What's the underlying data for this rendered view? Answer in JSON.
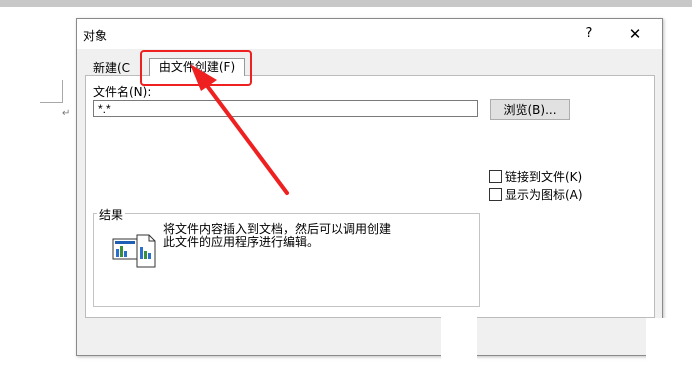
{
  "dialog": {
    "title": "对象",
    "help_label": "?",
    "close_label": "✕"
  },
  "tabs": {
    "create_new": "新建(C",
    "create_from_file": "由文件创建(F)"
  },
  "file": {
    "label": "文件名(N):",
    "value": "*.*",
    "browse_label": "浏览(B)..."
  },
  "options": {
    "link_to_file": "链接到文件(K)",
    "display_as_icon": "显示为图标(A)"
  },
  "result": {
    "label": "结果",
    "line1": "将文件内容插入到文档，然后可以调用创建",
    "line2": "此文件的应用程序进行编辑。"
  },
  "document": {
    "paragraph_mark": "↵"
  },
  "colors": {
    "highlight": "#ee2020",
    "dialog_bg": "#f0f0f0"
  }
}
